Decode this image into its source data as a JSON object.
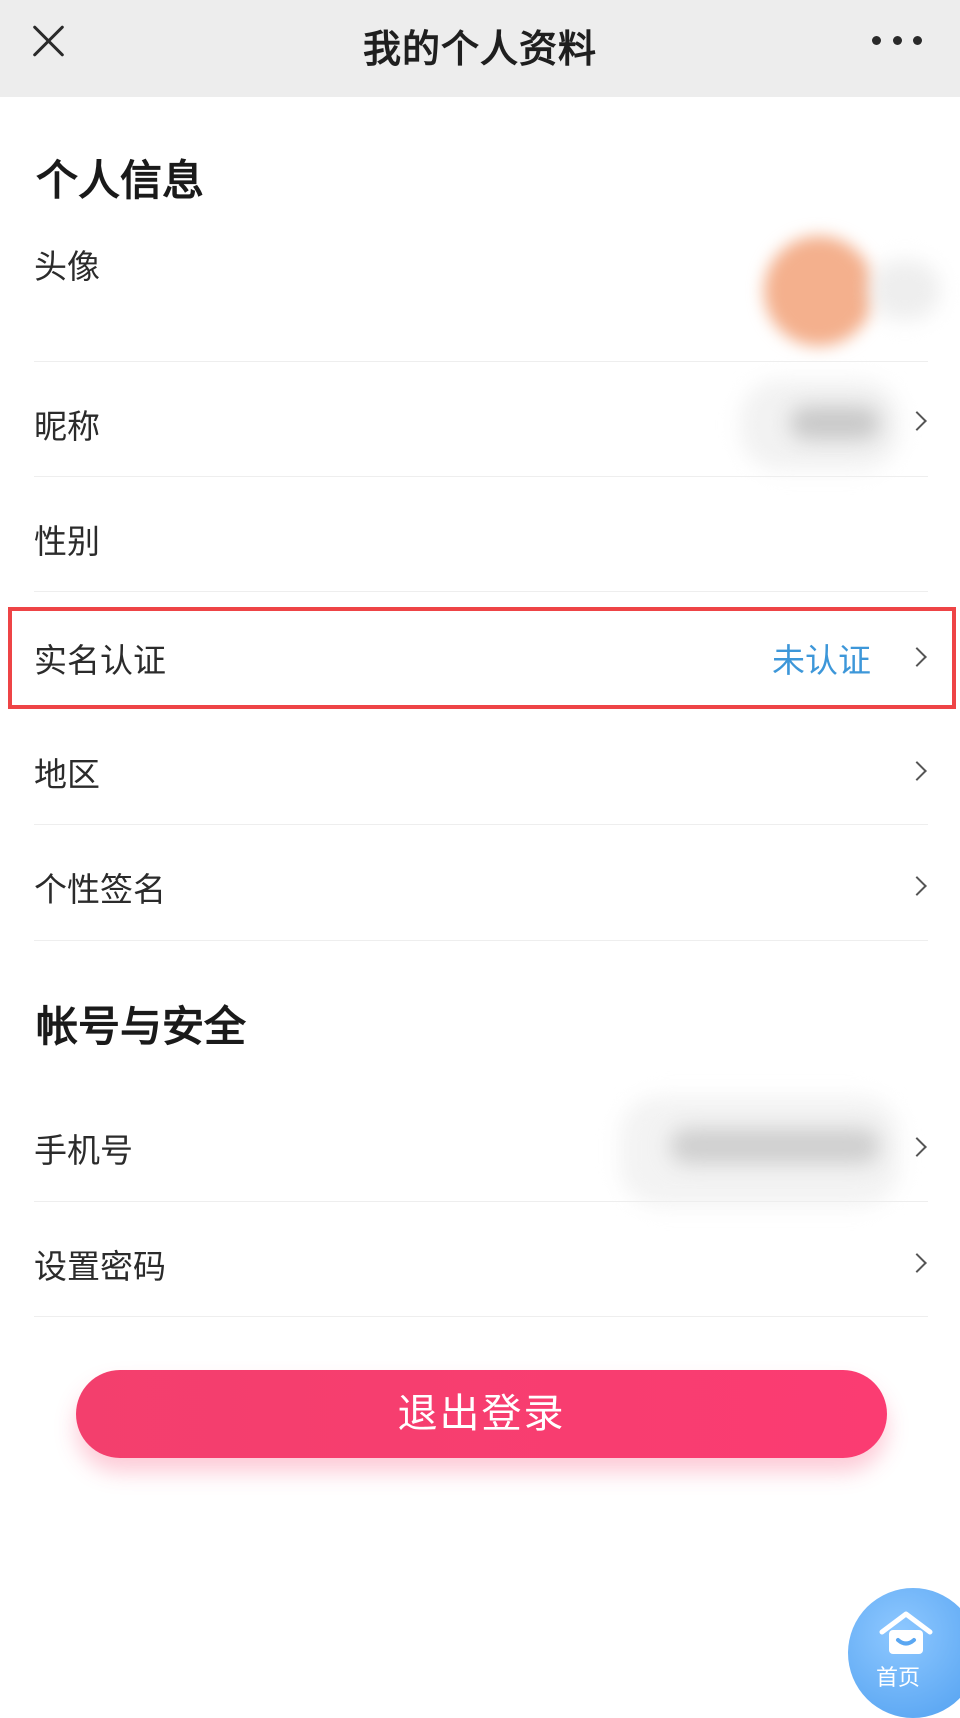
{
  "header": {
    "title": "我的个人资料",
    "close_icon": "close-icon",
    "more_icon": "more-dots-icon"
  },
  "personal_info": {
    "section_title": "个人信息",
    "rows": [
      {
        "label": "头像"
      },
      {
        "label": "昵称"
      },
      {
        "label": "性别"
      },
      {
        "label": "实名认证",
        "value": "未认证"
      },
      {
        "label": "地区"
      },
      {
        "label": "个性签名"
      }
    ]
  },
  "account_security": {
    "section_title": "帐号与安全",
    "rows": [
      {
        "label": "手机号"
      },
      {
        "label": "设置密码"
      }
    ]
  },
  "logout_button": "退出登录",
  "home_fab": {
    "label": "首页",
    "icon": "home-icon"
  },
  "colors": {
    "highlight_border": "#ee4446",
    "status_blue": "#3d97d9",
    "logout_pink": "#f8426f",
    "home_blue": "#5aa7f2"
  }
}
